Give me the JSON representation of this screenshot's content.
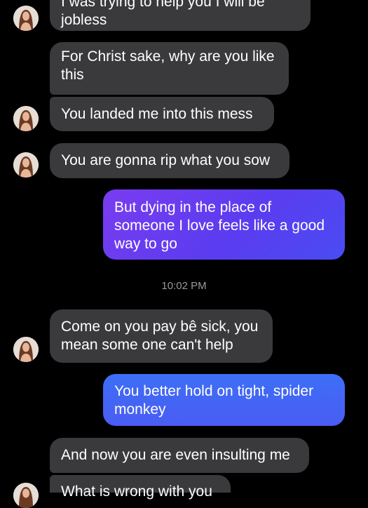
{
  "messages": [
    {
      "text": "I was trying to help you I will be\njobless"
    },
    {
      "text": "For Christ sake, why are you like\nthis"
    },
    {
      "text": "You landed me into this mess"
    },
    {
      "text": "You are gonna rip what you sow"
    },
    {
      "text": "But dying in the place of\nsomeone I love feels like a good\nway to go"
    },
    {
      "text": "Come on you pay bê sick, you\nmean some one can't help"
    },
    {
      "text": "You better hold on tight,  spider\nmonkey"
    },
    {
      "text": "And now you are even insulting me"
    },
    {
      "text": "What is wrong with you"
    }
  ],
  "timestamp": "10:02 PM",
  "avatar_icon": "contact-avatar-icon"
}
